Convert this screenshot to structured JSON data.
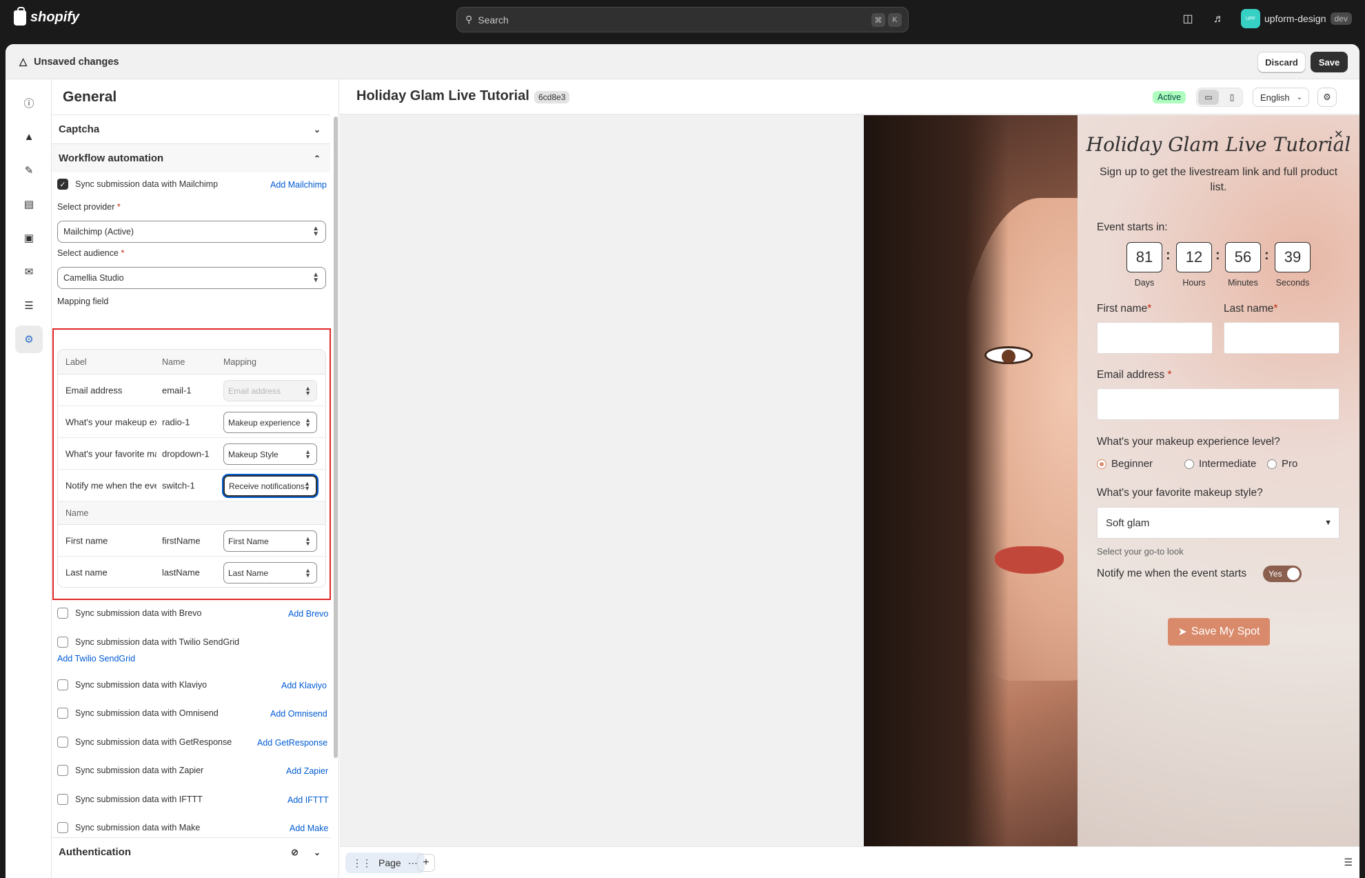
{
  "topbar": {
    "logo_text": "shopify",
    "search_placeholder": "Search",
    "kbd_cmd": "⌘",
    "kbd_k": "K",
    "store_avatar": "UPF",
    "store_name": "upform-design",
    "store_tag": "dev"
  },
  "unsaved": {
    "message": "Unsaved changes",
    "discard": "Discard",
    "save": "Save"
  },
  "icon_rail": [
    "info-icon",
    "megaphone-icon",
    "brush-icon",
    "form-icon",
    "receipt-icon",
    "mail-icon",
    "filter-icon",
    "settings-icon"
  ],
  "panel": {
    "title": "General",
    "captcha": "Captcha",
    "workflow": "Workflow automation",
    "mailchimp": {
      "label": "Sync submission data with Mailchimp",
      "link": "Add Mailchimp",
      "checked": true
    },
    "provider_label": "Select provider",
    "provider_value": "Mailchimp (Active)",
    "audience_label": "Select audience",
    "audience_value": "Camellia Studio",
    "mapping_label": "Mapping field",
    "headers": {
      "label": "Label",
      "name": "Name",
      "mapping": "Mapping"
    },
    "rows": [
      {
        "label": "Email address",
        "name": "email-1",
        "mapping": "Email address",
        "disabled": true
      },
      {
        "label": "What's your makeup experience level?",
        "name": "radio-1",
        "mapping": "Makeup experience"
      },
      {
        "label": "What's your favorite makeup style?",
        "name": "dropdown-1",
        "mapping": "Makeup Style"
      },
      {
        "label": "Notify me when the event starts",
        "name": "switch-1",
        "mapping": "Receive notifications",
        "focused": true
      }
    ],
    "name_group_header": "Name",
    "name_rows": [
      {
        "label": "First name",
        "name": "firstName",
        "mapping": "First Name"
      },
      {
        "label": "Last name",
        "name": "lastName",
        "mapping": "Last Name"
      }
    ],
    "integrations": [
      {
        "label": "Sync submission data with Brevo",
        "link": "Add Brevo"
      },
      {
        "label": "Sync submission data with Twilio SendGrid",
        "link": "Add Twilio SendGrid"
      },
      {
        "label": "Sync submission data with Klaviyo",
        "link": "Add Klaviyo"
      },
      {
        "label": "Sync submission data with Omnisend",
        "link": "Add Omnisend"
      },
      {
        "label": "Sync submission data with GetResponse",
        "link": "Add GetResponse"
      },
      {
        "label": "Sync submission data with Zapier",
        "link": "Add Zapier"
      },
      {
        "label": "Sync submission data with IFTTT",
        "link": "Add IFTTT"
      },
      {
        "label": "Sync submission data with Make",
        "link": "Add Make"
      }
    ],
    "authentication": "Authentication"
  },
  "preview": {
    "title": "Holiday Glam Live Tutorial",
    "hash": "6cd8e3",
    "status": "Active",
    "language": "English",
    "page_tab": "Page",
    "form": {
      "title": "Holiday Glam Live Tutorial",
      "subtitle": "Sign up to get the livestream link and full product list.",
      "countdown_label": "Event starts in:",
      "countdown": [
        {
          "value": "81",
          "unit": "Days"
        },
        {
          "value": "12",
          "unit": "Hours"
        },
        {
          "value": "56",
          "unit": "Minutes"
        },
        {
          "value": "39",
          "unit": "Seconds"
        }
      ],
      "first_name": "First name",
      "last_name": "Last name",
      "email": "Email address",
      "experience_q": "What's your makeup experience level?",
      "experience_opts": [
        "Beginner",
        "Intermediate",
        "Pro"
      ],
      "style_q": "What's your favorite makeup style?",
      "style_value": "Soft glam",
      "style_helper": "Select your go-to look",
      "notify_label": "Notify me when the event starts",
      "notify_value": "Yes",
      "submit": "Save My Spot"
    }
  }
}
